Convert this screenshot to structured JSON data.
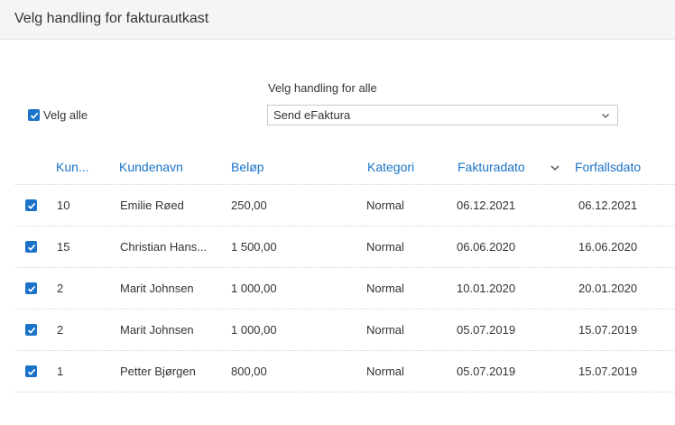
{
  "header": {
    "title": "Velg handling for fakturautkast"
  },
  "select_all": {
    "label": "Velg alle",
    "checked": true
  },
  "action": {
    "label": "Velg handling for alle",
    "selected": "Send eFaktura"
  },
  "columns": [
    {
      "key": "number",
      "label": "Kun..."
    },
    {
      "key": "customer",
      "label": "Kundenavn"
    },
    {
      "key": "amount",
      "label": "Beløp"
    },
    {
      "key": "category",
      "label": "Kategori"
    },
    {
      "key": "invoice_date",
      "label": "Fakturadato",
      "sorted": "descending"
    },
    {
      "key": "due_date",
      "label": "Forfallsdato"
    }
  ],
  "rows": [
    {
      "checked": true,
      "number": "10",
      "customer": "Emilie Røed",
      "amount": "250,00",
      "category": "Normal",
      "invoice_date": "06.12.2021",
      "due_date": "06.12.2021"
    },
    {
      "checked": true,
      "number": "15",
      "customer": "Christian Hans...",
      "amount": "1 500,00",
      "category": "Normal",
      "invoice_date": "06.06.2020",
      "due_date": "16.06.2020"
    },
    {
      "checked": true,
      "number": "2",
      "customer": "Marit Johnsen",
      "amount": "1 000,00",
      "category": "Normal",
      "invoice_date": "10.01.2020",
      "due_date": "20.01.2020"
    },
    {
      "checked": true,
      "number": "2",
      "customer": "Marit Johnsen",
      "amount": "1 000,00",
      "category": "Normal",
      "invoice_date": "05.07.2019",
      "due_date": "15.07.2019"
    },
    {
      "checked": true,
      "number": "1",
      "customer": "Petter Bjørgen",
      "amount": "800,00",
      "category": "Normal",
      "invoice_date": "05.07.2019",
      "due_date": "15.07.2019"
    }
  ],
  "colors": {
    "accent": "#1a73c8",
    "header_bg": "#f5f5f5",
    "text": "#333333"
  },
  "icons": {
    "checkbox": "checkmark-icon",
    "select": "chevron-down-icon",
    "sort": "sort-descending-icon"
  }
}
